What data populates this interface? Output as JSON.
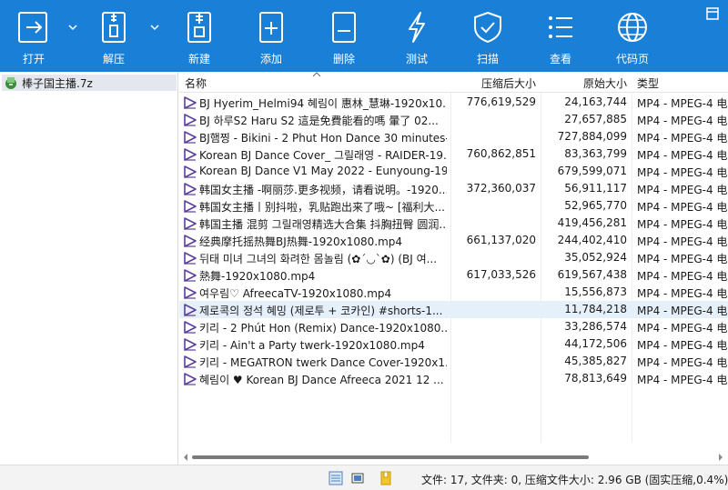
{
  "toolbar": {
    "buttons": [
      {
        "label": "打开",
        "icon": "open-icon"
      },
      {
        "label": "解压",
        "icon": "extract-icon"
      },
      {
        "label": "新建",
        "icon": "new-archive-icon"
      },
      {
        "label": "添加",
        "icon": "add-icon"
      },
      {
        "label": "删除",
        "icon": "delete-icon"
      },
      {
        "label": "测试",
        "icon": "test-icon"
      },
      {
        "label": "扫描",
        "icon": "scan-shield-icon"
      },
      {
        "label": "查看",
        "icon": "view-list-icon"
      },
      {
        "label": "代码页",
        "icon": "globe-icon"
      }
    ]
  },
  "sidebar": {
    "archive_name": "棒子国主播.7z"
  },
  "columns": {
    "name": "名称",
    "compressed": "压缩后大小",
    "original": "原始大小",
    "type": "类型"
  },
  "rows": [
    {
      "name": "BJ Hyerim_Helmi94 혜림이 惠林_慧琳-1920x10...",
      "compressed": "776,619,529",
      "original": "24,163,744",
      "type": "MP4 - MPEG-4 电"
    },
    {
      "name": "BJ 하루S2 Haru S2  這是免費能看的嗎 暈了  02...",
      "compressed": "",
      "original": "27,657,885",
      "type": "MP4 - MPEG-4 电"
    },
    {
      "name": "BJ햄찡 - Bikini - 2 Phut Hon Dance 30 minutes-...",
      "compressed": "",
      "original": "727,884,099",
      "type": "MP4 - MPEG-4 电"
    },
    {
      "name": "Korean BJ Dance Cover_ 그릴래영 - RAIDER-19...",
      "compressed": "760,862,851",
      "original": "83,363,799",
      "type": "MP4 - MPEG-4 电"
    },
    {
      "name": "Korean BJ Dance V1 May 2022 - Eunyoung-19...",
      "compressed": "",
      "original": "679,599,071",
      "type": "MP4 - MPEG-4 电"
    },
    {
      "name": "韩国女主播 -啊丽莎.更多视频，请看说明。-1920...",
      "compressed": "372,360,037",
      "original": "56,911,117",
      "type": "MP4 - MPEG-4 电"
    },
    {
      "name": "韩国女主播丨别抖啦，乳贴跑出来了哦~  [福利大...",
      "compressed": "",
      "original": "52,965,770",
      "type": "MP4 - MPEG-4 电"
    },
    {
      "name": "韩国主播 混剪 그릴래영精选大合集 抖胸扭臀 圆润...",
      "compressed": "",
      "original": "419,456,281",
      "type": "MP4 - MPEG-4 电"
    },
    {
      "name": "经典摩托摇热舞BJ热舞-1920x1080.mp4",
      "compressed": "661,137,020",
      "original": "244,402,410",
      "type": "MP4 - MPEG-4 电"
    },
    {
      "name": "뒤태 미녀 그녀의 화려한 몸놀림 (✿´◡`✿) (BJ 여...",
      "compressed": "",
      "original": "35,052,924",
      "type": "MP4 - MPEG-4 电"
    },
    {
      "name": "熱舞-1920x1080.mp4",
      "compressed": "617,033,526",
      "original": "619,567,438",
      "type": "MP4 - MPEG-4 电"
    },
    {
      "name": "여우림♡ AfreecaTV-1920x1080.mp4",
      "compressed": "",
      "original": "15,556,873",
      "type": "MP4 - MPEG-4 电"
    },
    {
      "name": "제로콕의 정석 혜밍 (제로투 + 코카인) #shorts-1...",
      "compressed": "",
      "original": "11,784,218",
      "type": "MP4 - MPEG-4 电"
    },
    {
      "name": "키리 - 2 Phút Hon (Remix) Dance-1920x1080....",
      "compressed": "",
      "original": "33,286,574",
      "type": "MP4 - MPEG-4 电"
    },
    {
      "name": "키리 - Ain't a Party twerk-1920x1080.mp4",
      "compressed": "",
      "original": "44,172,506",
      "type": "MP4 - MPEG-4 电"
    },
    {
      "name": "키리 - MEGATRON twerk Dance Cover-1920x1...",
      "compressed": "",
      "original": "45,385,827",
      "type": "MP4 - MPEG-4 电"
    },
    {
      "name": "혜림이 ♥   Korean BJ Dance  Afreeca 2021 12 ...",
      "compressed": "",
      "original": "78,813,649",
      "type": "MP4 - MPEG-4 电"
    }
  ],
  "selected_row": 12,
  "status": {
    "text": "文件: 17, 文件夹: 0, 压缩文件大小: 2.96 GB (固实压缩,0.4%)"
  },
  "colors": {
    "toolbar_bg": "#1a7fd6",
    "selection_bg": "#e6f0fb",
    "file_icon": "#5b3f99"
  }
}
